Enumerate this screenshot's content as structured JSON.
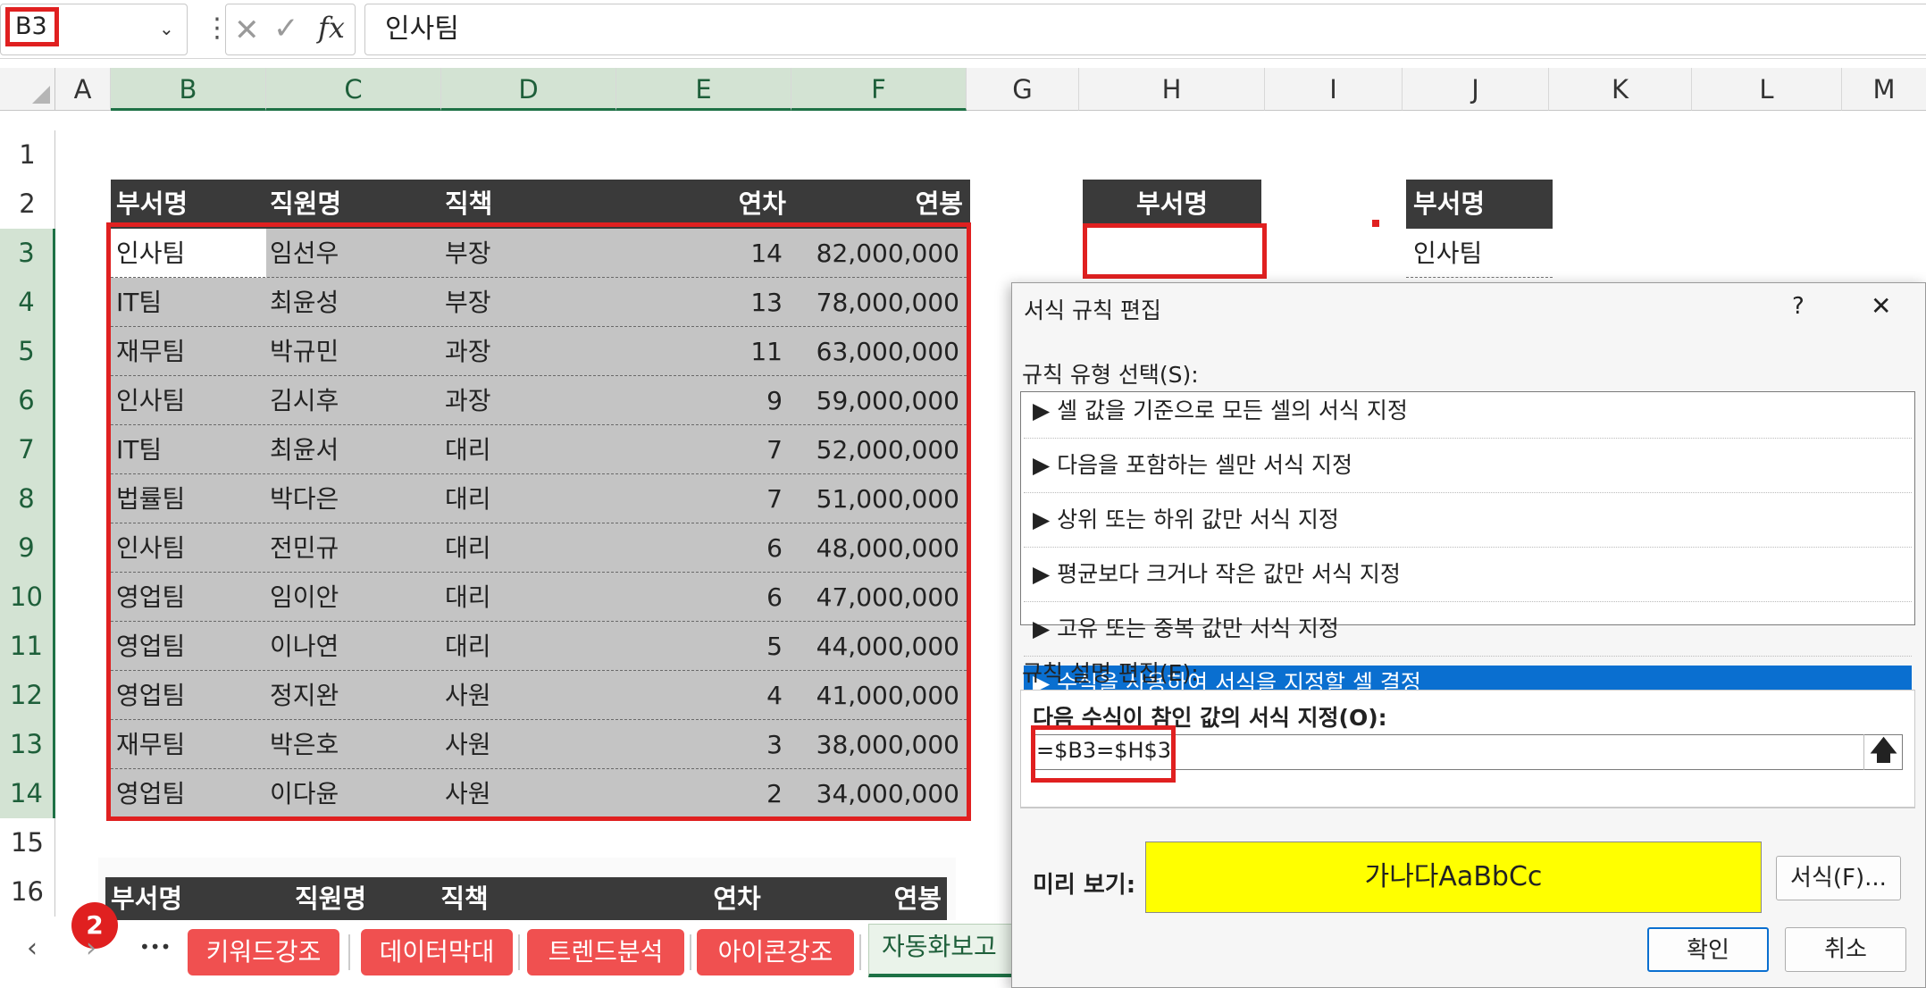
{
  "formula_bar": {
    "name_box": "B3",
    "formula": "인사팀"
  },
  "columns": [
    "A",
    "B",
    "C",
    "D",
    "E",
    "F",
    "G",
    "H",
    "I",
    "J",
    "K",
    "L",
    "M"
  ],
  "rows": [
    "1",
    "2",
    "3",
    "4",
    "5",
    "6",
    "7",
    "8",
    "9",
    "10",
    "11",
    "12",
    "13",
    "14",
    "15",
    "16"
  ],
  "main_table": {
    "headers": [
      "부서명",
      "직원명",
      "직책",
      "연차",
      "연봉"
    ],
    "rows": [
      [
        "인사팀",
        "임선우",
        "부장",
        "14",
        "82,000,000"
      ],
      [
        "IT팀",
        "최윤성",
        "부장",
        "13",
        "78,000,000"
      ],
      [
        "재무팀",
        "박규민",
        "과장",
        "11",
        "63,000,000"
      ],
      [
        "인사팀",
        "김시후",
        "과장",
        "9",
        "59,000,000"
      ],
      [
        "IT팀",
        "최윤서",
        "대리",
        "7",
        "52,000,000"
      ],
      [
        "법률팀",
        "박다은",
        "대리",
        "7",
        "51,000,000"
      ],
      [
        "인사팀",
        "전민규",
        "대리",
        "6",
        "48,000,000"
      ],
      [
        "영업팀",
        "임이안",
        "대리",
        "6",
        "47,000,000"
      ],
      [
        "영업팀",
        "이나연",
        "대리",
        "5",
        "44,000,000"
      ],
      [
        "영업팀",
        "정지완",
        "사원",
        "4",
        "41,000,000"
      ],
      [
        "재무팀",
        "박은호",
        "사원",
        "3",
        "38,000,000"
      ],
      [
        "영업팀",
        "이다윤",
        "사원",
        "2",
        "34,000,000"
      ]
    ]
  },
  "lookup_h": {
    "header": "부서명",
    "value": ""
  },
  "list_j": {
    "header": "부서명",
    "first": "인사팀"
  },
  "second_table": {
    "headers": [
      "부서명",
      "직원명",
      "직책",
      "연차",
      "연봉"
    ]
  },
  "badge": "2",
  "sheet_tabs": {
    "more": "•••",
    "tabs": [
      "키워드강조",
      "데이터막대",
      "트렌드분석",
      "아이콘강조",
      "자동화보고"
    ]
  },
  "dialog": {
    "title": "서식 규칙 편집",
    "help": "?",
    "close": "✕",
    "rule_type_label": "규칙 유형 선택(S):",
    "rule_types": [
      "▶ 셀 값을 기준으로 모든 셀의 서식 지정",
      "▶ 다음을 포함하는 셀만 서식 지정",
      "▶ 상위 또는 하위 값만 서식 지정",
      "▶ 평균보다 크거나 작은 값만 서식 지정",
      "▶ 고유 또는 중복 값만 서식 지정",
      "▶ 수식을 사용하여 서식을 지정할 셀 결정"
    ],
    "selected_rule_index": 5,
    "rule_desc_label": "규칙 설명 편집(E):",
    "formula_label": "다음 수식이 참인 값의 서식 지정(O):",
    "formula_value": "=$B3=$H$3",
    "preview_label": "미리 보기:",
    "preview_text": "가나다AaBbCc",
    "preview_color": "#ffff00",
    "format_button": "서식(F)...",
    "ok_button": "확인",
    "cancel_button": "취소"
  },
  "colors": {
    "header_bg": "#3a3a3a",
    "selection_bg": "#c4c4c4",
    "highlight_red": "#e02020",
    "accent_blue": "#0a6fd0",
    "tab_red": "#f05050",
    "excel_green": "#1e7145"
  }
}
